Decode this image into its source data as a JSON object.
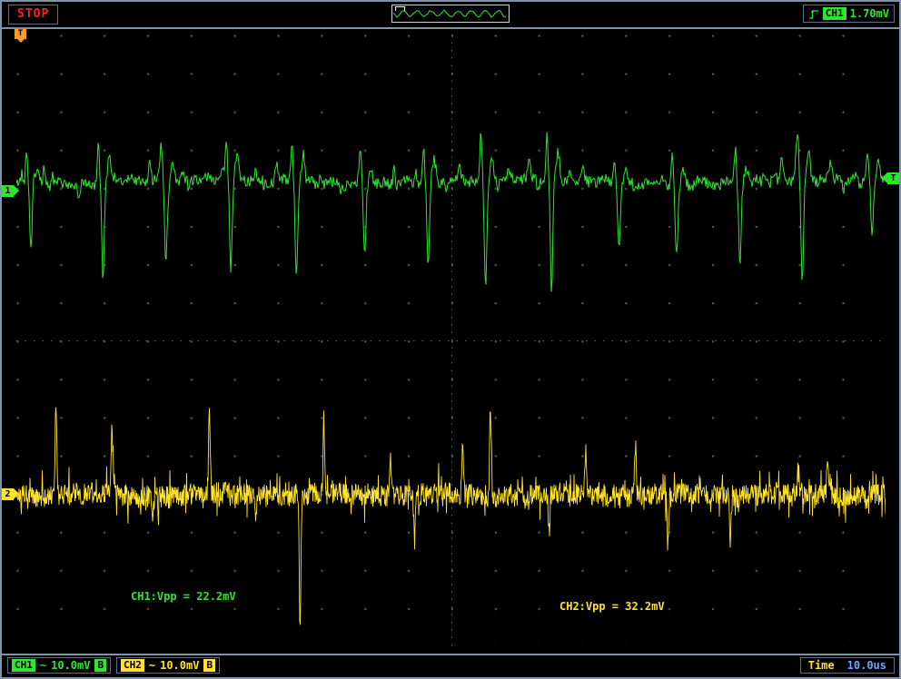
{
  "top_bar": {
    "run_state": "STOP",
    "trigger_readout": {
      "source": "CH1",
      "level": "1.70mV"
    }
  },
  "plot": {
    "markers": {
      "trigger_top": "T",
      "ch1": "1",
      "ch2": "2",
      "trigger_level": "T"
    },
    "annotations": {
      "ch1_vpp": "CH1:Vpp = 22.2mV",
      "ch2_vpp": "CH2:Vpp = 32.2mV"
    }
  },
  "bottom_bar": {
    "ch1": {
      "label": "CH1",
      "coupling": "~",
      "scale": "10.0mV",
      "bandwidth": "B"
    },
    "ch2": {
      "label": "CH2",
      "coupling": "~",
      "scale": "10.0mV",
      "bandwidth": "B"
    },
    "timebase": {
      "label": "Time",
      "value": "10.0us"
    }
  },
  "icons": {
    "trigger-edge-icon": "rising-edge glyph",
    "ch-coupling-icon": "~",
    "preview-window-marker": "window bracket"
  },
  "colors": {
    "ch1_green": "#2fe62f",
    "ch2_yellow": "#ffe22e",
    "trigger_orange": "#ff9b21",
    "stop_red": "#ff2222",
    "frame_blue": "#8193ab",
    "time_value_blue": "#6ea6ff",
    "grid_dot": "#4d555e"
  },
  "waveforms": {
    "ch1": {
      "color": "#2fe62f",
      "baseline": 162,
      "noise": 13,
      "spike_depth_min": 65,
      "spike_depth_max": 135,
      "seed": 1337
    },
    "ch2": {
      "color": "#ffe22e",
      "baseline": 507,
      "noise": 24,
      "spike_min": 22,
      "spike_max": 160,
      "seed": 2024
    },
    "preview": {
      "color": "#2fe62f",
      "seed": 7
    }
  }
}
